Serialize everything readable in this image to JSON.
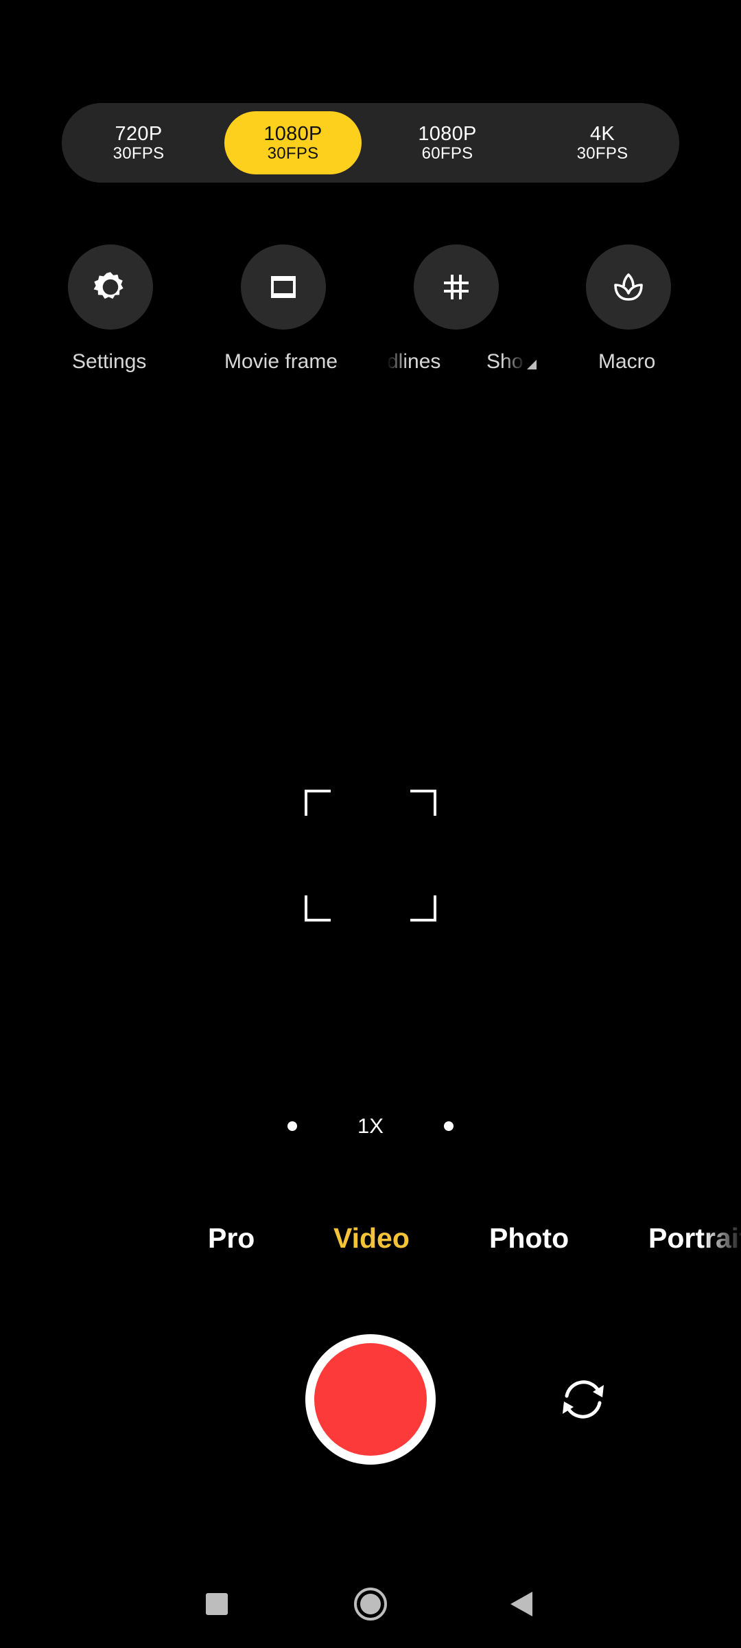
{
  "resolution_options": [
    {
      "res": "720P",
      "fps": "30FPS",
      "selected": false
    },
    {
      "res": "1080P",
      "fps": "30FPS",
      "selected": true
    },
    {
      "res": "1080P",
      "fps": "60FPS",
      "selected": false
    },
    {
      "res": "4K",
      "fps": "30FPS",
      "selected": false
    }
  ],
  "quick_settings": [
    {
      "label": "Settings",
      "icon": "gear-icon"
    },
    {
      "label": "Movie frame",
      "icon": "movie-frame-icon"
    },
    {
      "label": "Gridlines",
      "visible_text": "dlines",
      "icon": "grid-icon"
    },
    {
      "label": "Sho",
      "icon": null
    },
    {
      "label": "Macro",
      "icon": "macro-flower-icon"
    }
  ],
  "zoom": {
    "label": "1X"
  },
  "modes": [
    {
      "label": "Pro",
      "selected": false
    },
    {
      "label": "Video",
      "selected": true
    },
    {
      "label": "Photo",
      "selected": false
    },
    {
      "label": "Portrait",
      "selected": false
    }
  ],
  "colors": {
    "accent": "#fdd01d",
    "active_mode": "#f4c33a",
    "record": "#fd3a3a",
    "background": "#000000"
  },
  "nav": {
    "icons": [
      "recents-square-icon",
      "home-circle-icon",
      "back-triangle-icon"
    ]
  }
}
